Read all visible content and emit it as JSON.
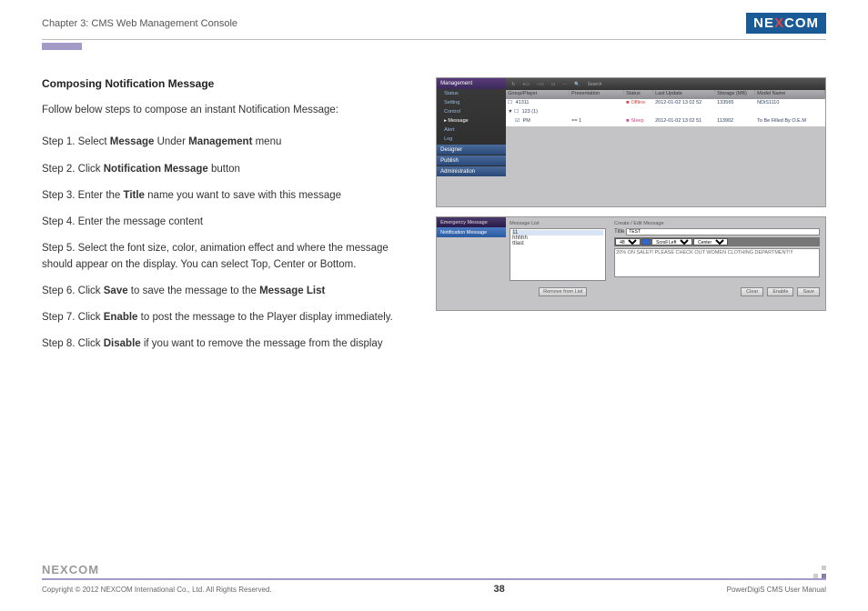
{
  "header": {
    "chapter": "Chapter 3: CMS Web Management Console",
    "logo": "NEXCOM"
  },
  "section": {
    "heading": "Composing Notification Message",
    "intro": "Follow below steps to compose an instant Notification Message:",
    "steps": [
      {
        "pre": "Step 1. Select ",
        "b1": "Message",
        "mid": " Under ",
        "b2": "Management",
        "post": " menu"
      },
      {
        "pre": "Step 2. Click ",
        "b1": "Notification Message",
        "mid": "",
        "b2": "",
        "post": " button"
      },
      {
        "pre": "Step 3. Enter the ",
        "b1": "Title",
        "mid": "",
        "b2": "",
        "post": " name you want to save with this message"
      },
      {
        "pre": "Step 4. Enter the message content",
        "b1": "",
        "mid": "",
        "b2": "",
        "post": ""
      },
      {
        "pre": "Step 5. Select the font size, color, animation effect and where the message should appear on the display. You can select Top, Center or Bottom.",
        "b1": "",
        "mid": "",
        "b2": "",
        "post": ""
      },
      {
        "pre": "Step 6. Click ",
        "b1": "Save",
        "mid": " to save the message to the ",
        "b2": "Message List",
        "post": ""
      },
      {
        "pre": "Step 7. Click ",
        "b1": "Enable",
        "mid": "",
        "b2": "",
        "post": " to post the message to the Player display immediately."
      },
      {
        "pre": "Step 8. Click ",
        "b1": "Disable",
        "mid": "",
        "b2": "",
        "post": " if you want to remove the message from the display"
      }
    ]
  },
  "app": {
    "toolbar": {
      "search": "Search"
    },
    "sidebar": {
      "management": "Management",
      "subs": [
        "Status",
        "Setting",
        "Control",
        "Message",
        "Alert",
        "Log"
      ],
      "designer": "Designer",
      "publish": "Publish",
      "admin": "Administration"
    },
    "table": {
      "cols": [
        "Group/Player",
        "Presentation",
        "Status",
        "Last Update",
        "Storage (MB)",
        "Model Name"
      ],
      "row1": [
        "41311",
        "",
        "Offline",
        "2012-01-02 13 02 52",
        "133565",
        "NDiS1110"
      ],
      "row2": [
        "123 (1)",
        "",
        "",
        "",
        "",
        ""
      ],
      "row3": [
        "PM",
        "== 1",
        "Sleep",
        "2012-01-02 13 02 51",
        "113902",
        "To Be Filled By O.E.M"
      ]
    },
    "msg": {
      "tab_em": "Emergency Message",
      "tab_no": "Notification Message",
      "list_lbl": "Message List",
      "list_items": [
        "11",
        "hhhhh",
        "ttlast"
      ],
      "remove": "Remove from List",
      "edit_lbl": "Create / Edit Message",
      "title_lbl": "Title",
      "title_val": "TEST",
      "fontsize": "48",
      "anim": "Scroll Left",
      "pos": "Center",
      "text": "20% ON SALE!!! PLEASE CHECK OUT WOMEN CLOTHING DEPARTMENT!!!",
      "clear": "Clear",
      "enable": "Enable",
      "save": "Save"
    }
  },
  "footer": {
    "logo": "NEXCOM",
    "copyright": "Copyright © 2012 NEXCOM International Co., Ltd. All Rights Reserved.",
    "page": "38",
    "manual": "PowerDigiS CMS User Manual"
  }
}
